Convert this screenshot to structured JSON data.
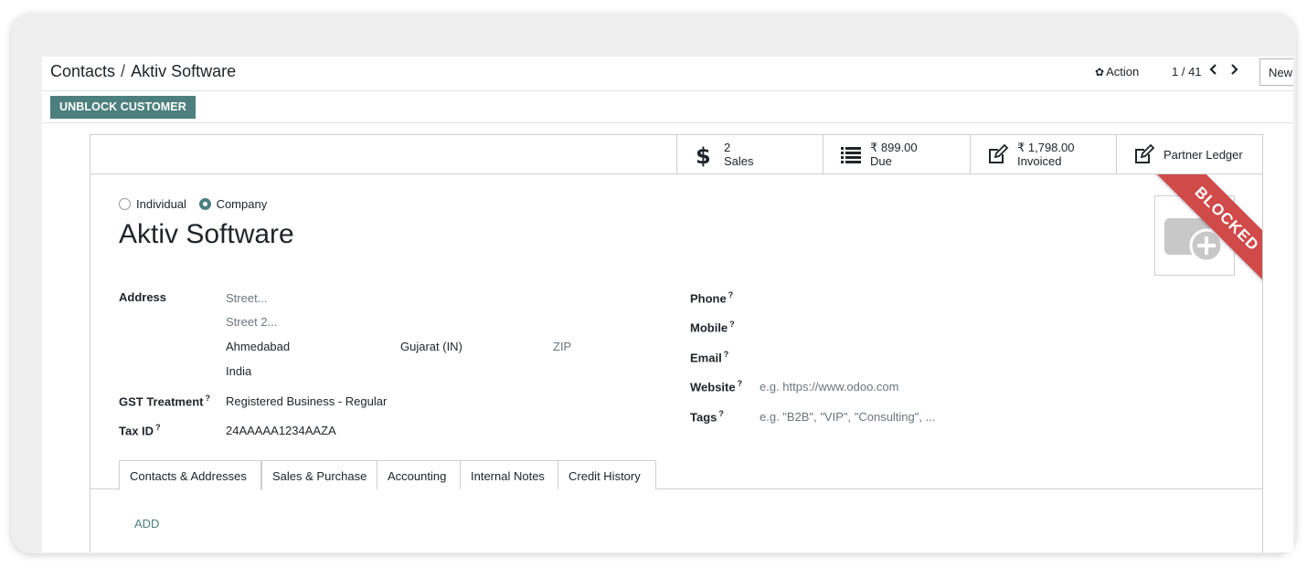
{
  "breadcrumb": {
    "parent": "Contacts",
    "separator": "/",
    "current": "Aktiv Software"
  },
  "control": {
    "action_label": "Action",
    "pager": "1 / 41",
    "new_label": "New"
  },
  "statusbar": {
    "unblock_label": "UNBLOCK CUSTOMER"
  },
  "stats": [
    {
      "icon": "dollar-icon",
      "value": "2",
      "label": "Sales"
    },
    {
      "icon": "list-icon",
      "value": "₹ 899.00",
      "label": "Due"
    },
    {
      "icon": "pencil-square-icon",
      "value": "₹ 1,798.00",
      "label": "Invoiced"
    },
    {
      "icon": "pencil-square-icon",
      "label": "Partner Ledger"
    }
  ],
  "ribbon": "BLOCKED",
  "company_type": {
    "option_individual": "Individual",
    "option_company": "Company",
    "selected": "Company"
  },
  "name": "Aktiv Software",
  "address": {
    "label": "Address",
    "street_placeholder": "Street...",
    "street2_placeholder": "Street 2...",
    "city": "Ahmedabad",
    "state": "Gujarat (IN)",
    "zip_placeholder": "ZIP",
    "country": "India"
  },
  "gst": {
    "label": "GST Treatment",
    "value": "Registered Business - Regular"
  },
  "tax": {
    "label": "Tax ID",
    "value": "24AAAAA1234AAZA"
  },
  "right_fields": {
    "phone_label": "Phone",
    "mobile_label": "Mobile",
    "email_label": "Email",
    "website_label": "Website",
    "website_placeholder": "e.g. https://www.odoo.com",
    "tags_label": "Tags",
    "tags_placeholder": "e.g. \"B2B\", \"VIP\", \"Consulting\", ..."
  },
  "help_mark": "?",
  "tabs": [
    "Contacts & Addresses",
    "Sales & Purchase",
    "Accounting",
    "Internal Notes",
    "Credit History"
  ],
  "active_tab": "Contacts & Addresses",
  "add_label": "ADD",
  "colors": {
    "primary": "#4c7f7e",
    "ribbon": "#d04a4a"
  }
}
